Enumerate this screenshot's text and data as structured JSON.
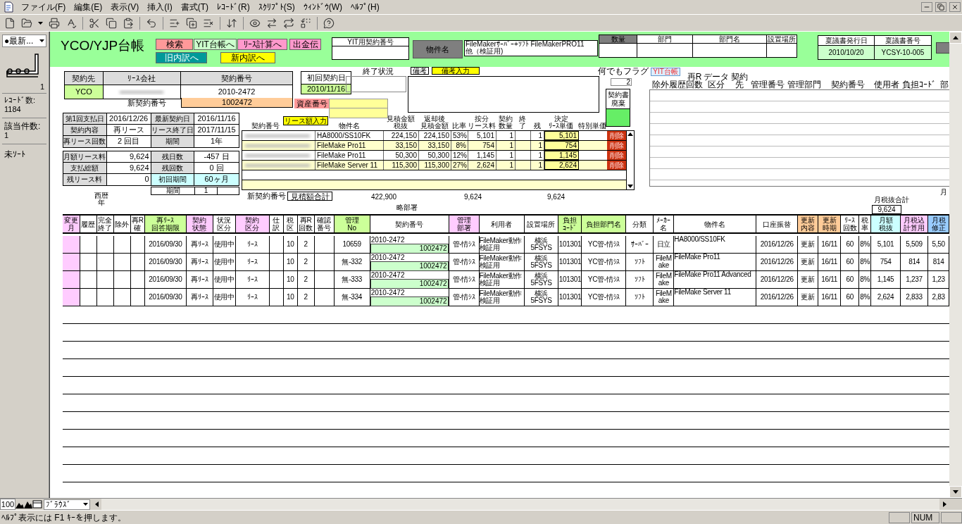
{
  "menu_bar": [
    "ファイル(F)",
    "編集(E)",
    "表示(V)",
    "挿入(I)",
    "書式(T)",
    "ﾚｺｰﾄﾞ(R)",
    "ｽｸﾘﾌﾟﾄ(S)",
    "ｳｨﾝﾄﾞｳ(W)",
    "ﾍﾙﾌﾟ(H)"
  ],
  "record_panel": {
    "layout_menu": "●最新...",
    "record": "1",
    "record_count_label": "ﾚｺｰﾄﾞ数:",
    "record_count": "1184",
    "found_label": "該当件数:",
    "found_count": "1",
    "sort_status": "未ｿｰﾄ"
  },
  "header": {
    "title": "YCO/YJP台帳",
    "buttons": [
      {
        "label": "検索",
        "color": "#ff9999"
      },
      {
        "label": "YIT台帳へ",
        "color": "#ccffcc"
      },
      {
        "label": "ﾘｰｽ計算へ",
        "color": "#ff99cc"
      },
      {
        "label": "出金伝",
        "color": "#ff99cc"
      },
      {
        "label": "旧内訳へ",
        "color": "#009999"
      },
      {
        "label": "新内訳へ",
        "color": "#ffff00"
      }
    ],
    "yit_contract_label": "YIT用契約番号",
    "item_label": "物件名",
    "item_value": [
      "FileMakerｻｰﾊﾞｰ+ｿﾌﾄ  FileMakerPRO11",
      "他（検証用)"
    ],
    "quantity_columns": [
      "数量",
      "部門",
      "部門名",
      "設置場所"
    ],
    "approval": [
      {
        "label": "稟議書発行日",
        "value": "2010/10/20"
      },
      {
        "label": "稟議書番号",
        "value": "YCSY-10-005"
      }
    ]
  },
  "form": {
    "contract_columns": [
      "契約先",
      "ﾘｰｽ会社",
      "契約番号"
    ],
    "client": "YCO",
    "contract_no": "2010-2472",
    "new_contract_label": "新契約番号",
    "new_contract_no": "1002472",
    "first_contract_label": "初回契約日",
    "first_contract_date": "2010/11/16",
    "asset_label": "資産番号",
    "end_status_label": "終了状況",
    "note_button": "備考",
    "note_input_button": "備考入力",
    "flag_label": "何でもフラグ",
    "flag_value": "2",
    "discard_button": "契約書廃棄",
    "details": [
      {
        "cells": [
          {
            "label": "第1回支払日",
            "value": "2016/12/26"
          },
          {
            "label": "最新契約日",
            "value": "2016/11/16"
          }
        ]
      },
      {
        "cells": [
          {
            "label": "契約内容",
            "value": "再リース"
          },
          {
            "label": "リース終了日",
            "value": "2017/11/15"
          }
        ]
      },
      {
        "cells": [
          {
            "label": "再リース回数",
            "value": "2 回目"
          },
          {
            "label": "期間",
            "value": "1年"
          }
        ]
      }
    ],
    "payments": [
      {
        "cells": [
          {
            "label": "月額リース料",
            "value": "9,624"
          },
          {
            "label": "残日数",
            "value": "-457 日"
          }
        ]
      },
      {
        "cells": [
          {
            "label": "支払総額",
            "value": "9,624"
          },
          {
            "label": "残回数",
            "value": "0 回"
          }
        ]
      },
      {
        "cells": [
          {
            "label": "残リース料",
            "value": "0"
          },
          {
            "label": "初回期間",
            "value": "60ヶ月",
            "color": "#ccffff"
          }
        ]
      }
    ],
    "period_row": {
      "label": "期間",
      "value": "1"
    },
    "year_label": "西暦年",
    "dept_short_label": "略部署",
    "monthly_total_label": "月税抜合計",
    "monthly_total": "9,624",
    "edge_label": "月"
  },
  "portal": {
    "input_button": "リース額入力",
    "columns": [
      "契約番号",
      "物件名",
      [
        "見積金額",
        "税抜"
      ],
      [
        "返却後",
        "見積金額"
      ],
      "比率",
      [
        "按分",
        "リース料"
      ],
      [
        "契約",
        "数量"
      ],
      [
        "終",
        "了"
      ],
      "残",
      [
        "決定",
        "ﾘｰｽ単価"
      ],
      "特別単価"
    ],
    "rows": [
      {
        "item": "HA8000/SS10FK",
        "estimate": "224,150",
        "after_return": "224,150",
        "ratio": "53%",
        "allocated": "5,101",
        "quantity": "1",
        "remaining": "1",
        "decided": "5,101",
        "delete": "削除"
      },
      {
        "item": "FileMake Pro11",
        "estimate": "33,150",
        "after_return": "33,150",
        "ratio": "8%",
        "allocated": "754",
        "quantity": "1",
        "remaining": "1",
        "decided": "754",
        "delete": "削除"
      },
      {
        "item": "FileMake Pro11",
        "estimate": "50,300",
        "after_return": "50,300",
        "ratio": "12%",
        "allocated": "1,145",
        "quantity": "1",
        "remaining": "1",
        "decided": "1,145",
        "delete": "削除"
      },
      {
        "item": "FileMake  Server 11",
        "estimate": "115,300",
        "after_return": "115,300",
        "ratio": "27%",
        "allocated": "2,624",
        "quantity": "1",
        "remaining": "1",
        "decided": "2,624",
        "delete": "削除"
      }
    ],
    "totals": {
      "new_contract_label": "新契約番号",
      "estimate_total_label": "見積額合計",
      "estimate_total": "422,900",
      "allocated_total": "9,624",
      "decided_total": "9,624"
    }
  },
  "yit_panel": {
    "button": "YIT台帳",
    "columns": [
      "除外",
      "履歴",
      [
        "再R",
        "回数"
      ],
      [
        "データ",
        "区分"
      ],
      [
        "契約",
        "先"
      ],
      "管理番号",
      "管理部門",
      "契約番号",
      "使用者",
      "負担ｺｰﾄﾞ",
      "部"
    ]
  },
  "list": {
    "columns": [
      {
        "label": [
          "変更",
          "月"
        ],
        "kind": "flag",
        "color": "#ffccff"
      },
      {
        "label": "履歴",
        "kind": "text"
      },
      {
        "label": [
          "完全",
          "終了"
        ],
        "kind": "text"
      },
      {
        "label": "除外",
        "kind": "text"
      },
      {
        "label": [
          "再R",
          "確"
        ],
        "kind": "text"
      },
      {
        "label": [
          "再ﾘｰｽ",
          "回答期限"
        ],
        "kind": "text",
        "color": "#ccff99"
      },
      {
        "label": [
          "契約",
          "状態"
        ],
        "kind": "text",
        "color": "#ffccff"
      },
      {
        "label": [
          "状況",
          "区分"
        ],
        "kind": "text"
      },
      {
        "label": [
          "契約",
          "区分"
        ],
        "kind": "text",
        "color": "#ffccff"
      },
      {
        "label": [
          "仕",
          "訳"
        ],
        "kind": "text"
      },
      {
        "label": [
          "税",
          "区"
        ],
        "kind": "text"
      },
      {
        "label": [
          "再R",
          "回数"
        ],
        "kind": "text"
      },
      {
        "label": [
          "確認",
          "番号"
        ],
        "kind": "text"
      },
      {
        "label": [
          "管理",
          "No"
        ],
        "kind": "text",
        "color": "#ccff99"
      },
      {
        "label": "契約番号",
        "kind": "dual"
      },
      {
        "label": [
          "管理",
          "部署"
        ],
        "kind": "text",
        "color": "#ffccff"
      },
      {
        "label": "利用者",
        "kind": "text"
      },
      {
        "label": "設置場所",
        "kind": "text"
      },
      {
        "label": [
          "負担",
          "ｺｰﾄﾞ"
        ],
        "kind": "text",
        "color": "#ccff99"
      },
      {
        "label": "負担部門名",
        "kind": "text",
        "color": "#ccff99"
      },
      {
        "label": "分類",
        "kind": "text"
      },
      {
        "label": [
          "ﾒｰｶｰ",
          "名"
        ],
        "kind": "text"
      },
      {
        "label": "物件名",
        "kind": "text"
      },
      {
        "label": "口座振替",
        "kind": "text"
      },
      {
        "label": [
          "更新",
          "内容"
        ],
        "kind": "text",
        "color": "#ffcc99"
      },
      {
        "label": [
          "更新",
          "時期"
        ],
        "kind": "text",
        "color": "#ffcc99"
      },
      {
        "label": [
          "ﾘｰｽ",
          "回数"
        ],
        "kind": "text"
      },
      {
        "label": [
          "税",
          "率"
        ],
        "kind": "text"
      },
      {
        "label": [
          "月額",
          "税抜"
        ],
        "kind": "text",
        "color": "#ccffff"
      },
      {
        "label": [
          "月税込",
          "計算用"
        ],
        "kind": "text",
        "color": "#ffccff"
      },
      {
        "label": [
          "月税",
          "修正"
        ],
        "kind": "text",
        "color": "#99ccff"
      }
    ],
    "rows": [
      {
        "cells": [
          null,
          null,
          null,
          null,
          null,
          "2016/09/30",
          "再ﾘｰｽ",
          "使用中",
          "ﾘｰｽ",
          null,
          "10",
          "2",
          null,
          "10659",
          [
            "2010-2472",
            "1002472"
          ],
          "管-情ｼｽ",
          "FileMaker動作検証用",
          "横浜 5FSYS",
          "101301",
          "YC管-情ｼｽ",
          "ｻｰﾊﾞｰ",
          "日立",
          "HA8000/SS10FK",
          "2016/12/26",
          "更新",
          "16/11",
          "60",
          "8%",
          "5,101",
          "5,509",
          "5,50"
        ]
      },
      {
        "cells": [
          null,
          null,
          null,
          null,
          null,
          "2016/09/30",
          "再ﾘｰｽ",
          "使用中",
          "ﾘｰｽ",
          null,
          "10",
          "2",
          null,
          "無-332",
          [
            "2010-2472",
            "1002472"
          ],
          "管-情ｼｽ",
          "FileMaker動作検証用",
          "横浜 5FSYS",
          "101301",
          "YC管-情ｼｽ",
          "ｿﾌﾄ",
          "FileMake",
          "FileMake Pro11",
          "2016/12/26",
          "更新",
          "16/11",
          "60",
          "8%",
          "754",
          "814",
          "814"
        ]
      },
      {
        "cells": [
          null,
          null,
          null,
          null,
          null,
          "2016/09/30",
          "再ﾘｰｽ",
          "使用中",
          "ﾘｰｽ",
          null,
          "10",
          "2",
          null,
          "無-333",
          [
            "2010-2472",
            "1002472"
          ],
          "管-情ｼｽ",
          "FileMaker動作検証用",
          "横浜 5FSYS",
          "101301",
          "YC管-情ｼｽ",
          "ｿﾌﾄ",
          "FileMake",
          "FileMake Pro11 Advanced",
          "2016/12/26",
          "更新",
          "16/11",
          "60",
          "8%",
          "1,145",
          "1,237",
          "1,23"
        ]
      },
      {
        "cells": [
          null,
          null,
          null,
          null,
          null,
          "2016/09/30",
          "再ﾘｰｽ",
          "使用中",
          "ﾘｰｽ",
          null,
          "10",
          "2",
          null,
          "無-334",
          [
            "2010-2472",
            "1002472"
          ],
          "管-情ｼｽ",
          "FileMaker動作検証用",
          "横浜 5FSYS",
          "101301",
          "YC管-情ｼｽ",
          "ｿﾌﾄ",
          "FileMake",
          "FileMake  Server 11",
          "2016/12/26",
          "更新",
          "16/11",
          "60",
          "8%",
          "2,624",
          "2,833",
          "2,83"
        ]
      }
    ]
  },
  "bottom_bar": {
    "zoom": "100",
    "mode": "ﾌﾞﾗｳｽﾞ"
  },
  "status_bar": {
    "message": "ﾍﾙﾌﾟ表示には F1 ｷｰを押します。",
    "num": "NUM"
  }
}
